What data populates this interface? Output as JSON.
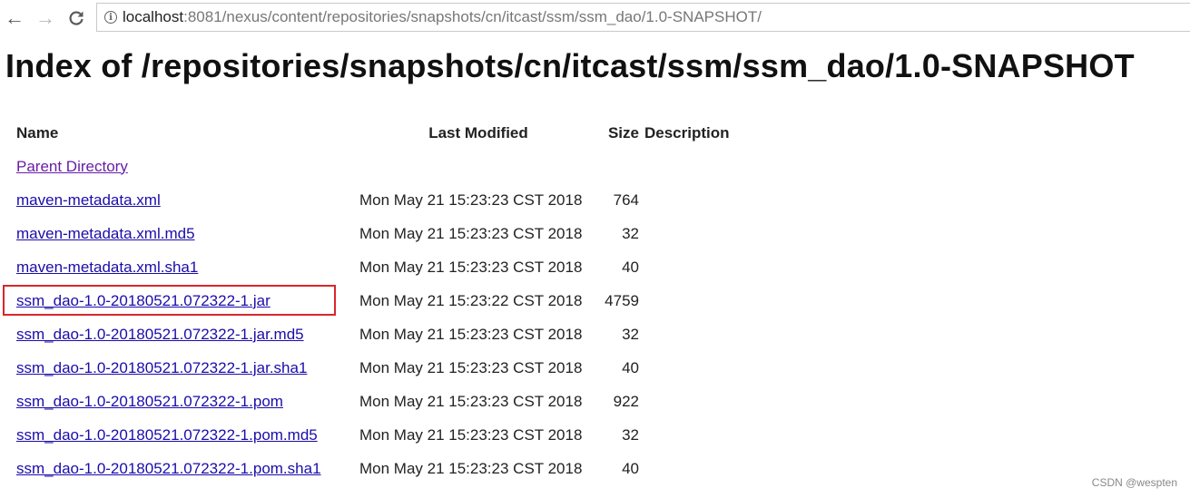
{
  "browser": {
    "back_icon": "arrow-left-icon",
    "forward_icon": "arrow-right-icon",
    "reload_icon": "reload-icon",
    "info_icon": "info-icon",
    "url_host": "localhost",
    "url_path": ":8081/nexus/content/repositories/snapshots/cn/itcast/ssm/ssm_dao/1.0-SNAPSHOT/"
  },
  "page": {
    "title": "Index of /repositories/snapshots/cn/itcast/ssm/ssm_dao/1.0-SNAPSHOT"
  },
  "table": {
    "headers": {
      "name": "Name",
      "last_modified": "Last Modified",
      "size": "Size",
      "description": "Description"
    },
    "parent_link": "Parent Directory",
    "rows": [
      {
        "name": "maven-metadata.xml",
        "last_modified": "Mon May 21 15:23:23 CST 2018",
        "size": "764"
      },
      {
        "name": "maven-metadata.xml.md5",
        "last_modified": "Mon May 21 15:23:23 CST 2018",
        "size": "32"
      },
      {
        "name": "maven-metadata.xml.sha1",
        "last_modified": "Mon May 21 15:23:23 CST 2018",
        "size": "40"
      },
      {
        "name": "ssm_dao-1.0-20180521.072322-1.jar",
        "last_modified": "Mon May 21 15:23:22 CST 2018",
        "size": "4759"
      },
      {
        "name": "ssm_dao-1.0-20180521.072322-1.jar.md5",
        "last_modified": "Mon May 21 15:23:23 CST 2018",
        "size": "32"
      },
      {
        "name": "ssm_dao-1.0-20180521.072322-1.jar.sha1",
        "last_modified": "Mon May 21 15:23:23 CST 2018",
        "size": "40"
      },
      {
        "name": "ssm_dao-1.0-20180521.072322-1.pom",
        "last_modified": "Mon May 21 15:23:23 CST 2018",
        "size": "922"
      },
      {
        "name": "ssm_dao-1.0-20180521.072322-1.pom.md5",
        "last_modified": "Mon May 21 15:23:23 CST 2018",
        "size": "32"
      },
      {
        "name": "ssm_dao-1.0-20180521.072322-1.pom.sha1",
        "last_modified": "Mon May 21 15:23:23 CST 2018",
        "size": "40"
      }
    ]
  },
  "colors": {
    "link": "#1a0dab",
    "visited_link": "#681da8",
    "highlight_border": "#d8262b"
  },
  "watermark": "CSDN @wespten"
}
